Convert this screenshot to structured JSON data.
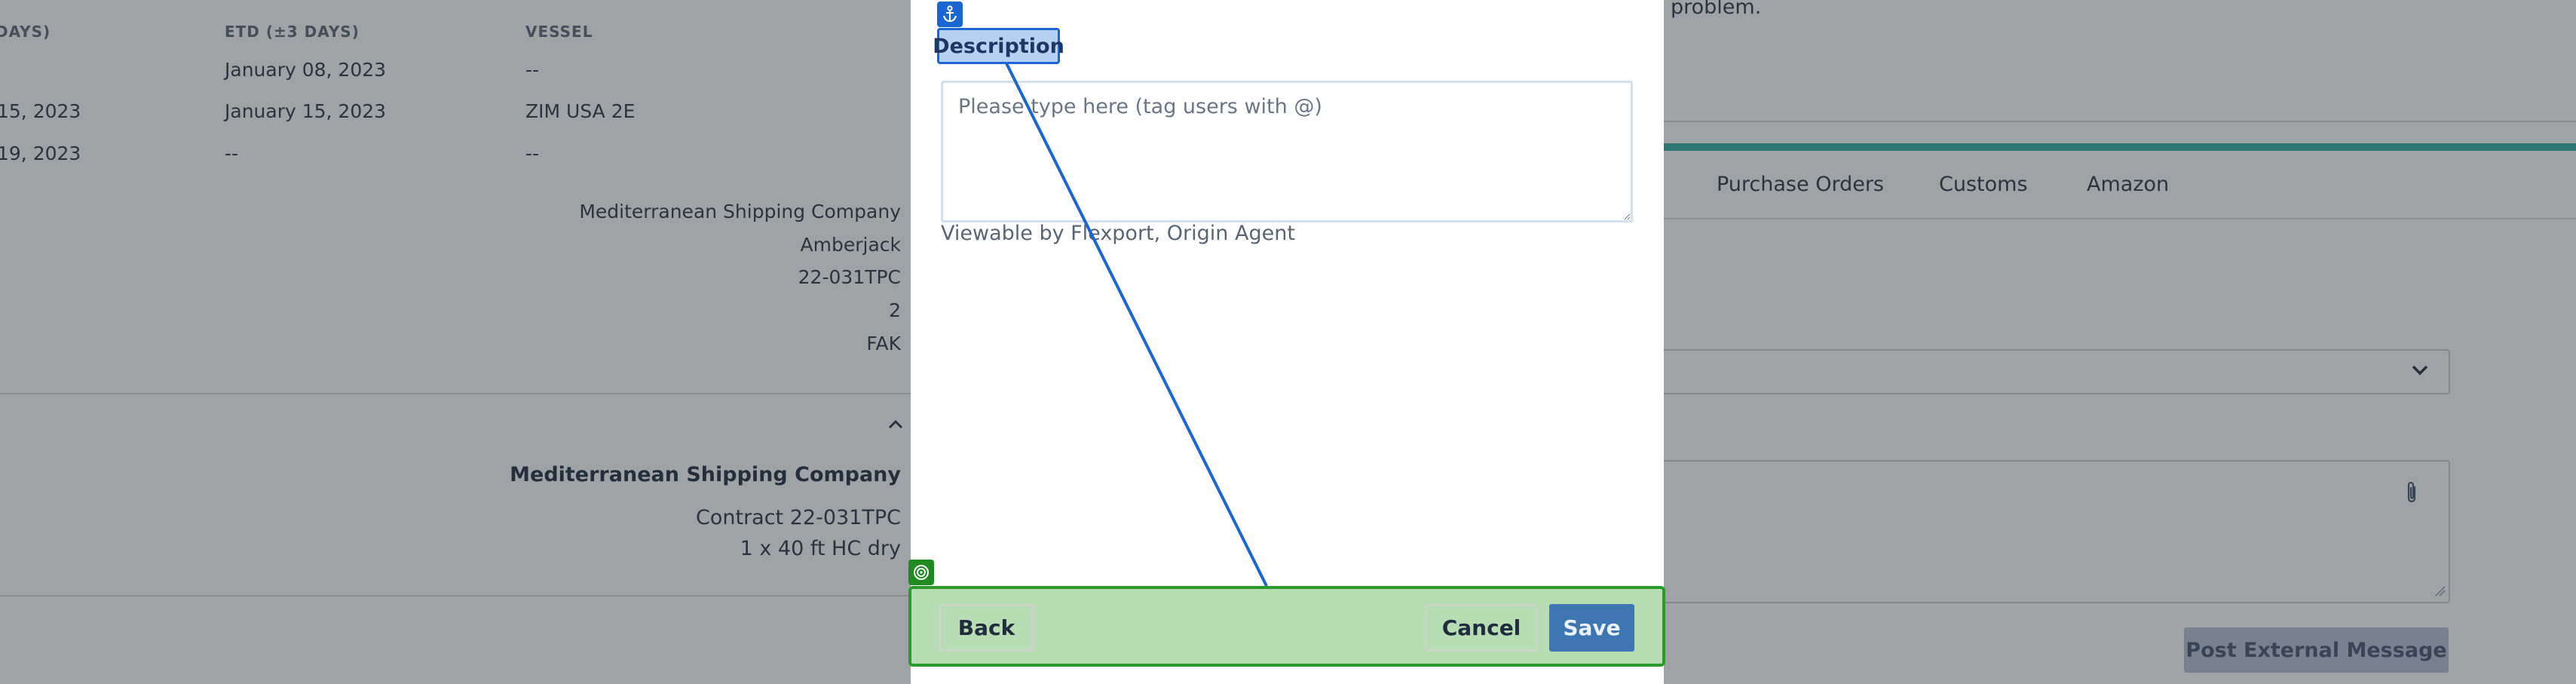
{
  "background": {
    "table": {
      "headers": [
        "DAYS)",
        "ETD (±3 DAYS)",
        "VESSEL"
      ],
      "rows": [
        [
          "",
          "January 08, 2023",
          "--"
        ],
        [
          "15, 2023",
          "January 15, 2023",
          "ZIM USA 2E"
        ],
        [
          "19, 2023",
          "--",
          "--"
        ]
      ]
    },
    "details": [
      "Mediterranean Shipping Company",
      "Amberjack",
      "22-031TPC",
      "2",
      "FAK"
    ],
    "collapse_icon": "chevron-up-icon",
    "contract": {
      "carrier": "Mediterranean Shipping Company",
      "contract": "Contract 22-031TPC",
      "containers": "1 x 40 ft HC dry"
    },
    "top_text": "problem.",
    "tabs": [
      "Purchase Orders",
      "Customs",
      "Amazon"
    ],
    "select_icon": "chevron-down-icon",
    "attach_icon": "paperclip-icon",
    "post_button": "Post External Message"
  },
  "modal": {
    "description_label": "Description",
    "description_placeholder": "Please type here (tag users with @)",
    "viewable_text": "Viewable by Flexport, Origin Agent",
    "back_button": "Back",
    "cancel_button": "Cancel",
    "save_button": "Save",
    "anchor_icon": "anchor-icon",
    "target_icon": "target-icon"
  },
  "colors": {
    "accent": "#1a66d2",
    "footer_highlight": "#2a9a2a",
    "save": "#3e76b3",
    "teal": "#2bb3a0"
  }
}
